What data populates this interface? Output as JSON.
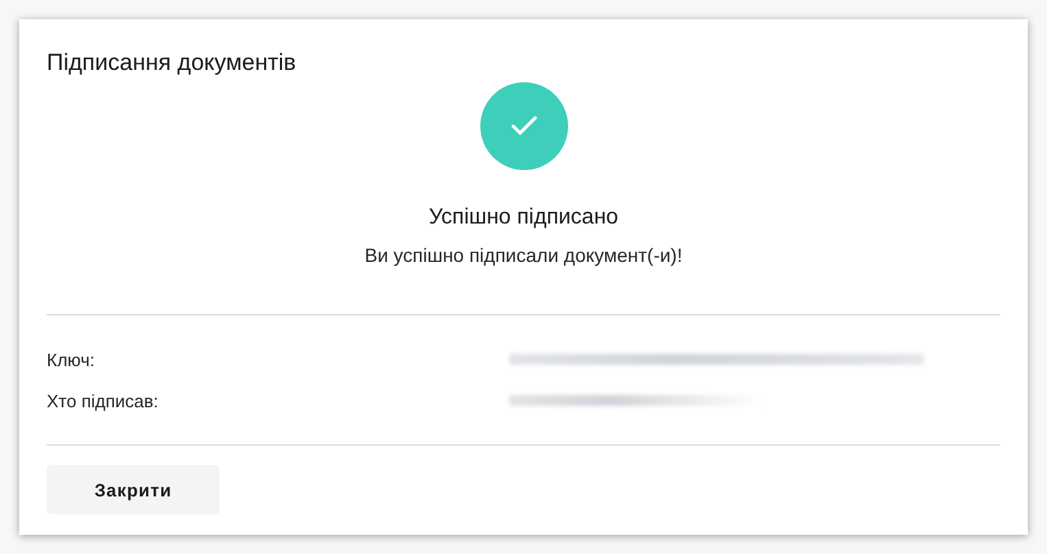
{
  "dialog": {
    "title": "Підписання документів",
    "status": {
      "kind": "success",
      "heading": "Успішно підписано",
      "message": "Ви успішно підписали документ(-и)!"
    },
    "details": [
      {
        "label": "Ключ:"
      },
      {
        "label": "Хто підписав:"
      }
    ],
    "buttons": [
      "Закрити"
    ]
  }
}
